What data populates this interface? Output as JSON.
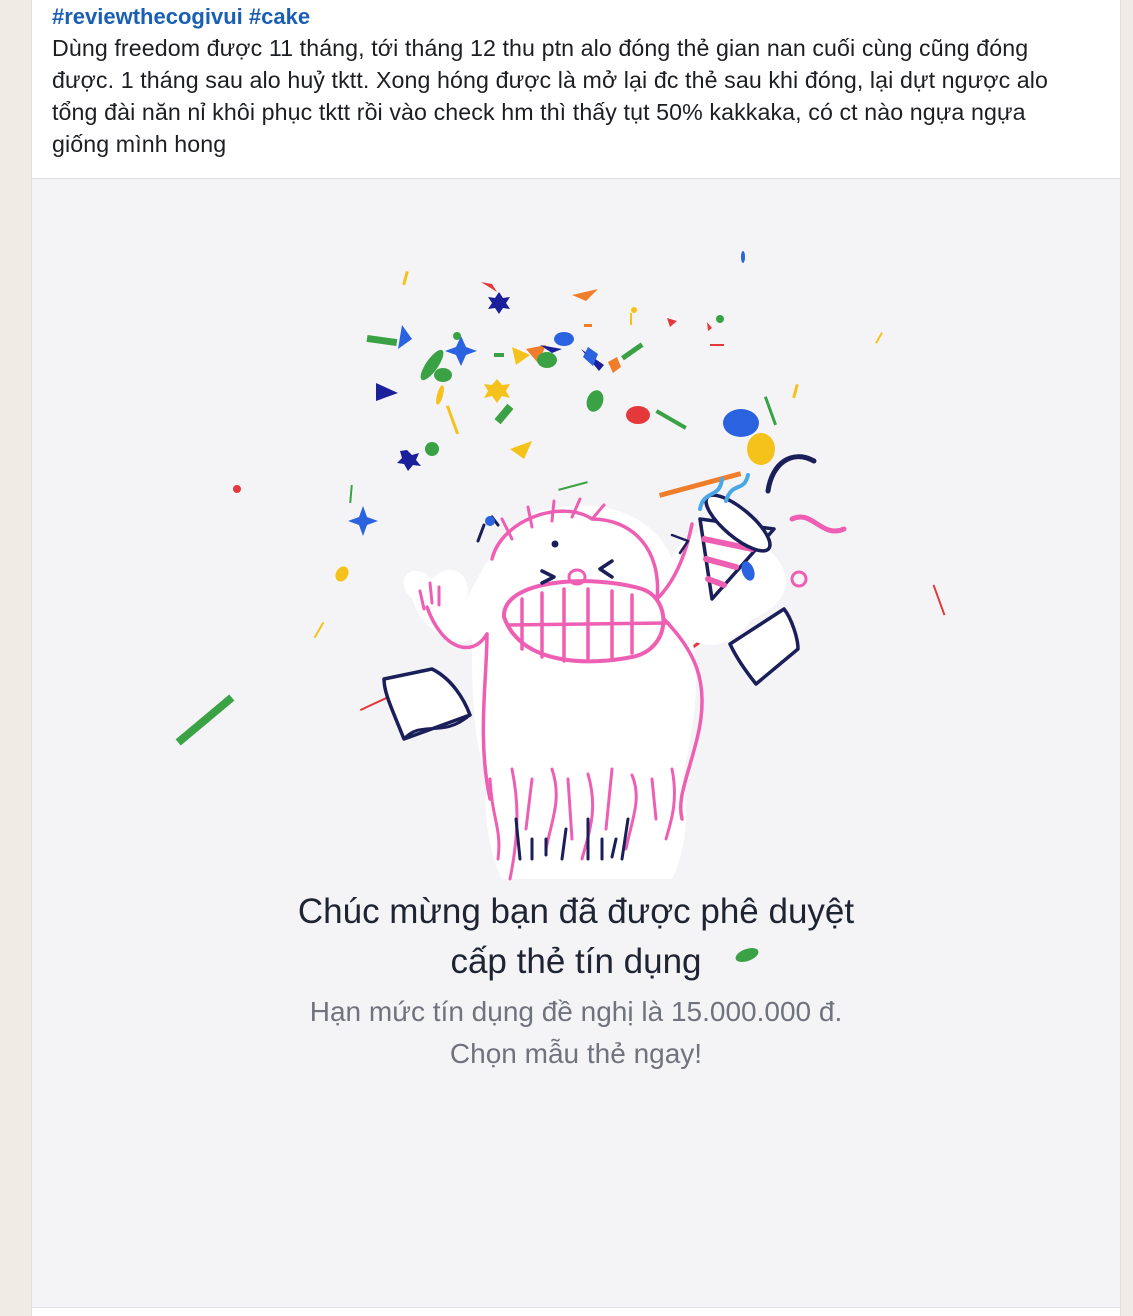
{
  "post": {
    "hashtags": [
      "#reviewthecogivui",
      "#cake"
    ],
    "lines": [
      "Dùng freedom được 11 tháng, tới tháng 12 thu ptn alo đóng thẻ gian nan cuối cùng cũng đóng",
      "được. 1 tháng sau alo huỷ tktt. Xong hóng được là mở lại đc thẻ sau khi đóng, lại dựt ngược alo",
      "tổng đài năn nỉ khôi phục tktt rồi vào check hm thì thấy tụt 50% kakkaka, có ct nào ngựa ngựa",
      "giống mình hong"
    ]
  },
  "screenshot": {
    "title_lines": [
      "Chúc mừng bạn đã được phê duyệt",
      "cấp thẻ tín dụng"
    ],
    "subtitle_lines": [
      "Hạn mức tín dụng đề nghị là 15.000.000 đ.",
      "Chọn mẫu thẻ ngay!"
    ],
    "illustration": "celebrating-monster-with-party-popper",
    "colors": {
      "hashtag": "#1a5fb4",
      "monster_outline": "#ee5fb4",
      "ink": "#1a1f5a",
      "confetti_blue": "#2a62e0",
      "confetti_green": "#3aa244",
      "confetti_yellow": "#f5c21b",
      "confetti_red": "#e5383b",
      "confetti_orange": "#f07d2a"
    }
  }
}
